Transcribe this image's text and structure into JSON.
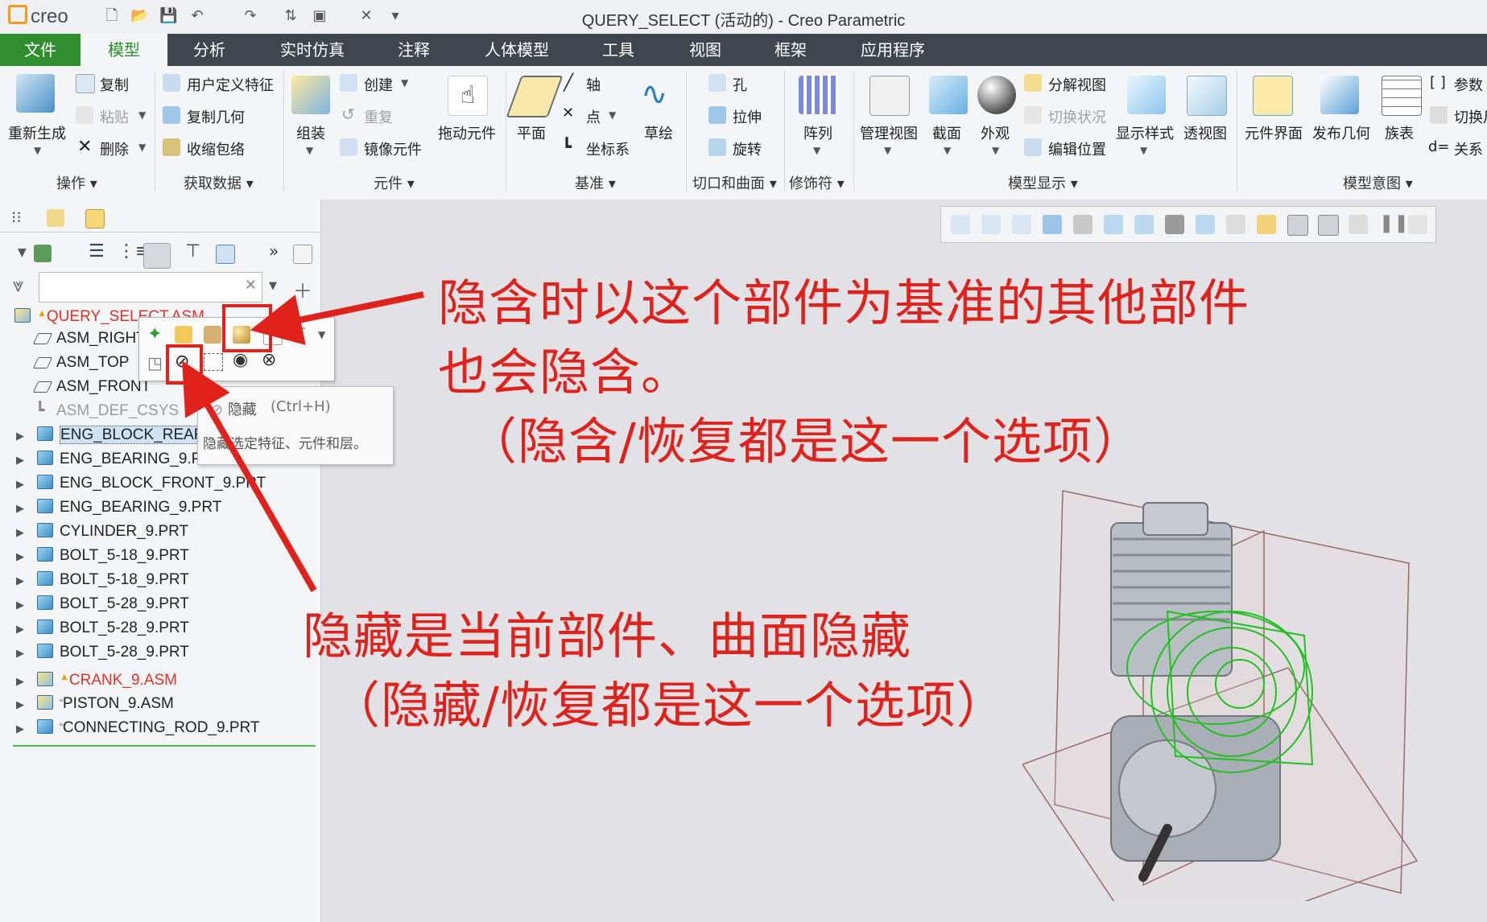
{
  "app": {
    "logo_text": "creo",
    "window_title": "QUERY_SELECT (活动的) - Creo Parametric"
  },
  "menu_tabs": [
    "文件",
    "模型",
    "分析",
    "实时仿真",
    "注释",
    "人体模型",
    "工具",
    "视图",
    "框架",
    "应用程序"
  ],
  "ribbon": {
    "operations": {
      "regenerate": "重新生成",
      "copy": "复制",
      "paste": "粘贴",
      "delete": "删除",
      "group": "操作"
    },
    "get_data": {
      "udf": "用户定义特征",
      "copy_geom": "复制几何",
      "shrinkwrap": "收缩包络",
      "group": "获取数据"
    },
    "component": {
      "assemble": "组装",
      "create": "创建",
      "repeat": "重复",
      "mirror": "镜像元件",
      "drag": "拖动元件",
      "group": "元件"
    },
    "datum": {
      "plane": "平面",
      "axis": "轴",
      "point": "点",
      "csys": "坐标系",
      "sketch": "草绘",
      "group": "基准"
    },
    "cut_surface": {
      "hole": "孔",
      "extrude": "拉伸",
      "revolve": "旋转",
      "group": "切口和曲面"
    },
    "modifiers": {
      "pattern": "阵列",
      "group": "修饰符"
    },
    "model_display": {
      "manage_views": "管理视图",
      "section": "截面",
      "appearance": "外观",
      "explode": "分解视图",
      "toggle_status": "切换状况",
      "edit_position": "编辑位置",
      "display_style": "显示样式",
      "perspective": "透视图",
      "group": "模型显示"
    },
    "model_intent": {
      "comp_interface": "元件界面",
      "publish_geom": "发布几何",
      "family_table": "族表",
      "params": "参数",
      "switch": "切换尺",
      "relations": "关系",
      "group": "模型意图"
    }
  },
  "tree": {
    "root": "QUERY_SELECT.ASM",
    "items": [
      {
        "label": "ASM_RIGHT",
        "type": "plane"
      },
      {
        "label": "ASM_TOP",
        "type": "plane"
      },
      {
        "label": "ASM_FRONT",
        "type": "plane"
      },
      {
        "label": "ASM_DEF_CSYS",
        "type": "csys"
      },
      {
        "label": "ENG_BLOCK_REAR_9.PRT",
        "type": "part"
      },
      {
        "label": "ENG_BEARING_9.PRT",
        "type": "part"
      },
      {
        "label": "ENG_BLOCK_FRONT_9.PRT",
        "type": "part"
      },
      {
        "label": "ENG_BEARING_9.PRT",
        "type": "part"
      },
      {
        "label": "CYLINDER_9.PRT",
        "type": "part"
      },
      {
        "label": "BOLT_5-18_9.PRT",
        "type": "part"
      },
      {
        "label": "BOLT_5-18_9.PRT",
        "type": "part"
      },
      {
        "label": "BOLT_5-28_9.PRT",
        "type": "part"
      },
      {
        "label": "BOLT_5-28_9.PRT",
        "type": "part"
      },
      {
        "label": "BOLT_5-28_9.PRT",
        "type": "part"
      },
      {
        "label": "CRANK_9.ASM",
        "type": "asm"
      },
      {
        "label": "PISTON_9.ASM",
        "type": "asm"
      },
      {
        "label": "CONNECTING_ROD_9.PRT",
        "type": "asm"
      }
    ]
  },
  "tooltip": {
    "title": "隐藏",
    "shortcut": "(Ctrl+H)",
    "description": "隐藏选定特征、元件和层。"
  },
  "annotations": {
    "suppress_line1": "隐含时以这个部件为基准的其他部件",
    "suppress_line2": "也会隐含。",
    "suppress_line3": "（隐含/恢复都是这一个选项）",
    "hide_line1": "隐藏是当前部件、曲面隐藏",
    "hide_line2": "（隐藏/恢复都是这一个选项）"
  },
  "colors": {
    "accent_green": "#2f8f2f",
    "annotation_red": "#e0221c",
    "tab_bar": "#40464d"
  }
}
